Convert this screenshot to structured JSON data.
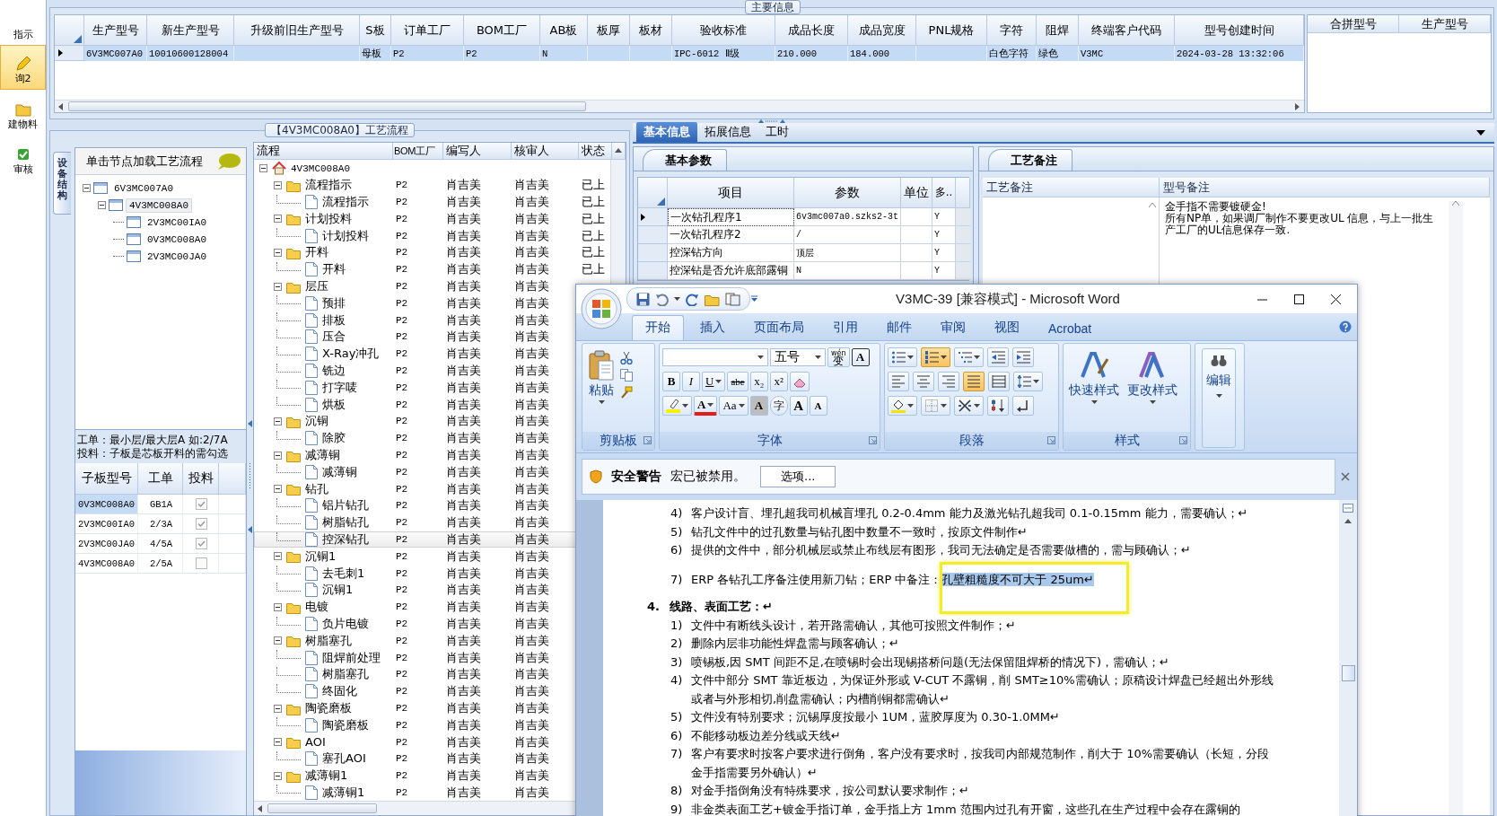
{
  "nav": [
    {
      "label": "指示",
      "selected": false
    },
    {
      "label": "询2",
      "selected": true
    },
    {
      "label": "建物料",
      "selected": false
    },
    {
      "label": "审核",
      "selected": false
    }
  ],
  "main_info": {
    "title": "主要信息",
    "columns": [
      "生产型号",
      "新生产型号",
      "升级前旧生产型号",
      "S板",
      "订单工厂",
      "BOM工厂",
      "AB板",
      "板厚",
      "板材",
      "验收标准",
      "成品长度",
      "成品宽度",
      "PNL规格",
      "字符",
      "阻焊",
      "终端客户代码",
      "型号创建时间"
    ],
    "rows": [
      {
        "selected": true,
        "cells": [
          "6V3MC007A0",
          "10010600128004",
          null,
          "母板",
          "P2",
          "P2",
          "N",
          null,
          null,
          "IPC-6012 Ⅱ级",
          "210.000",
          "184.000",
          null,
          "白色字符",
          "绿色",
          "V3MC",
          "2024-03-28 13:32:06"
        ]
      }
    ],
    "merge_columns": [
      "合拼型号",
      "生产型号"
    ]
  },
  "process": {
    "title": "【4V3MC008A0】工艺流程",
    "side_tab": "设备结构",
    "structure": {
      "header": "单击节点加载工艺流程",
      "tree": [
        {
          "label": "6V3MC007A0",
          "expanded": true,
          "selected": false,
          "children": [
            {
              "label": "4V3MC008A0",
              "expanded": true,
              "selected": true,
              "children": [
                {
                  "label": "2V3MC00IA0",
                  "selected": false
                },
                {
                  "label": "0V3MC008A0",
                  "selected": false
                },
                {
                  "label": "2V3MC00JA0",
                  "selected": false
                }
              ]
            }
          ]
        }
      ],
      "hint": [
        "工单：最小层/最大层A 如:2/7A",
        "投料：子板是芯板开料的需勾选"
      ],
      "sub_boards": {
        "columns": [
          "子板型号",
          "工单",
          "投料"
        ],
        "rows": [
          {
            "model": "0V3MC008A0",
            "order": "GB1A",
            "checked": true,
            "selected": true
          },
          {
            "model": "2V3MC00IA0",
            "order": "2/3A",
            "checked": true,
            "selected": false
          },
          {
            "model": "2V3MC00JA0",
            "order": "4/5A",
            "checked": true,
            "selected": false
          },
          {
            "model": "4V3MC008A0",
            "order": "2/5A",
            "checked": false,
            "selected": false
          }
        ]
      }
    },
    "flow": {
      "columns": [
        "流程",
        "BOM工厂",
        "编写人",
        "核审人",
        "状态"
      ],
      "root": {
        "label": "4V3MC008A0",
        "expanded": true,
        "selected": false,
        "children": [
          {
            "label": "流程指示",
            "bom": "P2",
            "author": "肖吉美",
            "reviewer": "肖吉美",
            "status": "已上",
            "expanded": true,
            "selected": false,
            "children": [
              {
                "label": "流程指示",
                "bom": "P2",
                "author": "肖吉美",
                "reviewer": "肖吉美",
                "status": "已上",
                "selected": false
              }
            ]
          },
          {
            "label": "计划投料",
            "bom": "P2",
            "author": "肖吉美",
            "reviewer": "肖吉美",
            "status": "已上",
            "expanded": true,
            "selected": false,
            "children": [
              {
                "label": "计划投料",
                "bom": "P2",
                "author": "肖吉美",
                "reviewer": "肖吉美",
                "status": "已上",
                "selected": false
              }
            ]
          },
          {
            "label": "开料",
            "bom": "P2",
            "author": "肖吉美",
            "reviewer": "肖吉美",
            "status": "已上",
            "expanded": true,
            "selected": false,
            "children": [
              {
                "label": "开料",
                "bom": "P2",
                "author": "肖吉美",
                "reviewer": "肖吉美",
                "status": "已上",
                "selected": false
              }
            ]
          },
          {
            "label": "层压",
            "bom": "P2",
            "author": "肖吉美",
            "reviewer": "肖吉美",
            "expanded": true,
            "selected": false,
            "children": [
              {
                "label": "预排",
                "bom": "P2",
                "author": "肖吉美",
                "reviewer": "肖吉美",
                "selected": false
              },
              {
                "label": "排板",
                "bom": "P2",
                "author": "肖吉美",
                "reviewer": "肖吉美",
                "selected": false
              },
              {
                "label": "压合",
                "bom": "P2",
                "author": "肖吉美",
                "reviewer": "肖吉美",
                "selected": false
              },
              {
                "label": "X-Ray冲孔",
                "bom": "P2",
                "author": "肖吉美",
                "reviewer": "肖吉美",
                "selected": false
              },
              {
                "label": "铣边",
                "bom": "P2",
                "author": "肖吉美",
                "reviewer": "肖吉美",
                "selected": false
              },
              {
                "label": "打字唛",
                "bom": "P2",
                "author": "肖吉美",
                "reviewer": "肖吉美",
                "selected": false
              },
              {
                "label": "烘板",
                "bom": "P2",
                "author": "肖吉美",
                "reviewer": "肖吉美",
                "selected": false
              }
            ]
          },
          {
            "label": "沉铜",
            "bom": "P2",
            "author": "肖吉美",
            "reviewer": "肖吉美",
            "expanded": true,
            "selected": false,
            "children": [
              {
                "label": "除胶",
                "bom": "P2",
                "author": "肖吉美",
                "reviewer": "肖吉美",
                "selected": false
              }
            ]
          },
          {
            "label": "减薄铜",
            "bom": "P2",
            "author": "肖吉美",
            "reviewer": "肖吉美",
            "expanded": true,
            "selected": false,
            "children": [
              {
                "label": "减薄铜",
                "bom": "P2",
                "author": "肖吉美",
                "reviewer": "肖吉美",
                "selected": false
              }
            ]
          },
          {
            "label": "钻孔",
            "bom": "P2",
            "author": "肖吉美",
            "reviewer": "肖吉美",
            "expanded": true,
            "selected": false,
            "children": [
              {
                "label": "铝片钻孔",
                "bom": "P2",
                "author": "肖吉美",
                "reviewer": "肖吉美",
                "selected": false
              },
              {
                "label": "树脂钻孔",
                "bom": "P2",
                "author": "肖吉美",
                "reviewer": "肖吉美",
                "selected": false
              },
              {
                "label": "控深钻孔",
                "bom": "P2",
                "author": "肖吉美",
                "reviewer": "肖吉美",
                "selected": true
              }
            ]
          },
          {
            "label": "沉铜1",
            "bom": "P2",
            "author": "肖吉美",
            "reviewer": "肖吉美",
            "expanded": true,
            "selected": false,
            "children": [
              {
                "label": "去毛刺1",
                "bom": "P2",
                "author": "肖吉美",
                "reviewer": "肖吉美",
                "selected": false
              },
              {
                "label": "沉铜1",
                "bom": "P2",
                "author": "肖吉美",
                "reviewer": "肖吉美",
                "selected": false
              }
            ]
          },
          {
            "label": "电镀",
            "bom": "P2",
            "author": "肖吉美",
            "reviewer": "肖吉美",
            "expanded": true,
            "selected": false,
            "children": [
              {
                "label": "负片电镀",
                "bom": "P2",
                "author": "肖吉美",
                "reviewer": "肖吉美",
                "selected": false
              }
            ]
          },
          {
            "label": "树脂塞孔",
            "bom": "P2",
            "author": "肖吉美",
            "reviewer": "肖吉美",
            "expanded": true,
            "selected": false,
            "children": [
              {
                "label": "阻焊前处理",
                "bom": "P2",
                "author": "肖吉美",
                "reviewer": "肖吉美",
                "selected": false
              },
              {
                "label": "树脂塞孔",
                "bom": "P2",
                "author": "肖吉美",
                "reviewer": "肖吉美",
                "selected": false
              },
              {
                "label": "终固化",
                "bom": "P2",
                "author": "肖吉美",
                "reviewer": "肖吉美",
                "selected": false
              }
            ]
          },
          {
            "label": "陶瓷磨板",
            "bom": "P2",
            "author": "肖吉美",
            "reviewer": "肖吉美",
            "expanded": true,
            "selected": false,
            "children": [
              {
                "label": "陶瓷磨板",
                "bom": "P2",
                "author": "肖吉美",
                "reviewer": "肖吉美",
                "selected": false
              }
            ]
          },
          {
            "label": "AOI",
            "bom": "P2",
            "author": "肖吉美",
            "reviewer": "肖吉美",
            "expanded": true,
            "selected": false,
            "children": [
              {
                "label": "塞孔AOI",
                "bom": "P2",
                "author": "肖吉美",
                "reviewer": "肖吉美",
                "selected": false
              }
            ]
          },
          {
            "label": "减薄铜1",
            "bom": "P2",
            "author": "肖吉美",
            "reviewer": "肖吉美",
            "expanded": true,
            "selected": false,
            "children": [
              {
                "label": "减薄铜1",
                "bom": "P2",
                "author": "肖吉美",
                "reviewer": "肖吉美",
                "selected": false
              }
            ]
          }
        ]
      }
    }
  },
  "details": {
    "tabs": [
      {
        "label": "基本信息",
        "selected": true
      },
      {
        "label": "拓展信息",
        "selected": false
      },
      {
        "label": "工时",
        "selected": false
      }
    ],
    "params": {
      "tab": "基本参数",
      "columns": [
        "项目",
        "参数",
        "单位",
        "多.."
      ],
      "rows": [
        {
          "item": "一次钻孔程序1",
          "value": "6v3mc007a0.szks2-3t",
          "flag": "Y",
          "current": true
        },
        {
          "item": "一次钻孔程序2",
          "value": "/",
          "flag": "Y",
          "current": false
        },
        {
          "item": "控深钻方向",
          "value": "顶层",
          "flag": "Y",
          "current": false
        },
        {
          "item": "控深钻是否允许底部露铜",
          "value": "N",
          "flag": "Y",
          "current": false
        }
      ]
    },
    "notes": {
      "tab": "工艺备注",
      "columns": [
        "工艺备注",
        "型号备注"
      ],
      "model_note": [
        "金手指不需要镀硬金!",
        "所有NP单，如果调厂制作不要更改UL 信息，与上一批生产工厂的UL信息保存一致."
      ]
    }
  },
  "word": {
    "title": "V3MC-39 [兼容模式] - Microsoft Word",
    "tabs": [
      {
        "label": "开始",
        "selected": true
      },
      {
        "label": "插入",
        "selected": false
      },
      {
        "label": "页面布局",
        "selected": false
      },
      {
        "label": "引用",
        "selected": false
      },
      {
        "label": "邮件",
        "selected": false
      },
      {
        "label": "审阅",
        "selected": false
      },
      {
        "label": "视图",
        "selected": false
      },
      {
        "label": "Acrobat",
        "selected": false
      }
    ],
    "ribbon": [
      {
        "kind": "clipboard",
        "label": "剪贴板",
        "paste": "粘贴"
      },
      {
        "kind": "font",
        "label": "字体",
        "size": "五号",
        "phonetic_top": "wén",
        "phonetic": "变",
        "border_char": "A",
        "format_buttons": [
          {
            "kind": "bold",
            "label": "B"
          },
          {
            "kind": "italic",
            "label": "I"
          },
          {
            "kind": "underline",
            "label": "U",
            "menu": true
          },
          {
            "kind": "strike",
            "label": "abe"
          },
          {
            "kind": "sub",
            "label": "x₂"
          },
          {
            "kind": "sup",
            "label": "x²"
          },
          {
            "kind": "clear"
          }
        ],
        "effect_buttons": [
          {
            "kind": "highlight",
            "menu": true
          },
          {
            "kind": "color",
            "label": "A",
            "menu": true
          },
          {
            "kind": "case",
            "label": "Aa",
            "menu": true
          },
          {
            "kind": "shade",
            "label": "A"
          },
          {
            "kind": "enclose",
            "label": "字"
          },
          {
            "kind": "grow",
            "label": "A"
          },
          {
            "kind": "shrink",
            "label": "A"
          }
        ]
      },
      {
        "kind": "paragraph",
        "label": "段落",
        "list_buttons": [
          {
            "kind": "bullets",
            "on": false,
            "menu": true
          },
          {
            "kind": "numbering",
            "on": true,
            "menu": true
          },
          {
            "kind": "multilevel",
            "on": false,
            "menu": true
          },
          {
            "kind": "outdent",
            "on": false
          },
          {
            "kind": "indent",
            "on": false
          }
        ],
        "align_buttons": [
          {
            "kind": "left",
            "on": false
          },
          {
            "kind": "center",
            "on": false
          },
          {
            "kind": "right",
            "on": false
          },
          {
            "kind": "justify",
            "on": true
          },
          {
            "kind": "distributed",
            "on": false
          },
          {
            "kind": "spacing",
            "on": false,
            "menu": true
          }
        ],
        "tool_buttons": [
          {
            "kind": "shading",
            "on": false,
            "menu": true
          },
          {
            "kind": "borders",
            "on": false,
            "menu": true
          },
          {
            "kind": "asian",
            "on": false,
            "menu": true
          },
          {
            "kind": "sort",
            "on": false
          },
          {
            "kind": "marks",
            "on": false
          }
        ]
      },
      {
        "kind": "styles",
        "label": "样式",
        "buttons": [
          "快速样式",
          "更改样式"
        ]
      },
      {
        "kind": "editing",
        "button": "编辑"
      }
    ],
    "security": {
      "title": "安全警告",
      "message": "宏已被禁用。",
      "button": "选项..."
    },
    "paragraphs": [
      {
        "kind": "item",
        "num": "4)",
        "text": "客户设计盲、埋孔超我司机械盲埋孔 0.2-0.4mm 能力及激光钻孔超我司 0.1-0.15mm 能力，需要确认；↵"
      },
      {
        "kind": "item",
        "num": "5)",
        "text": "钻孔文件中的过孔数量与钻孔图中数量不一致时，按原文件制作↵"
      },
      {
        "kind": "item",
        "num": "6)",
        "text": "提供的文件中，部分机械层或禁止布线层有图形，我司无法确定是否需要做槽的，需与顾确认；↵"
      },
      {
        "kind": "item",
        "num": "7)",
        "text": "ERP 各钻孔工序备注使用新刀钻；ERP 中备注：",
        "selection": "孔壁粗糙度不可大于 25um↵",
        "callout": true,
        "spaced": true
      },
      {
        "kind": "heading",
        "num": "4.",
        "text": "线路、表面工艺：↵"
      },
      {
        "kind": "item",
        "num": "1)",
        "text": "文件中有断线头设计，若开路需确认，其他可按照文件制作；↵"
      },
      {
        "kind": "item",
        "num": "2)",
        "text": "删除内层非功能性焊盘需与顾客确认；↵"
      },
      {
        "kind": "item",
        "num": "3)",
        "text": "喷锡板,因 SMT 间距不足,在喷锡时会出现锡搭桥问题(无法保留阻焊桥的情况下)，需确认；↵"
      },
      {
        "kind": "item",
        "num": "4)",
        "text": "文件中部分 SMT 靠近板边，为保证外形或 V-CUT 不露铜，削 SMT≥10%需确认；原稿设计焊盘已经超出外形线或者与外形相切,削盘需确认；内槽削铜都需确认↵"
      },
      {
        "kind": "item",
        "num": "5)",
        "text": "文件没有特别要求；沉锡厚度按最小 1UM，蓝胶厚度为 0.30-1.0MM↵"
      },
      {
        "kind": "item",
        "num": "6)",
        "text": "不能移动板边差分线或天线↵"
      },
      {
        "kind": "item",
        "num": "7)",
        "text": "客户有要求时按客户要求进行倒角，客户没有要求时，按我司内部规范制作，削大于 10%需要确认（长短，分段金手指需要另外确认）↵"
      },
      {
        "kind": "item",
        "num": "8)",
        "text": "对金手指倒角没有特殊要求，按公司默认要求制作；↵"
      },
      {
        "kind": "item",
        "num": "9)",
        "text": "非金类表面工艺+镀金手指订单，金手指上方 1mm 范围内过孔有开窗，这些孔在生产过程中会存在露铜的"
      }
    ]
  }
}
